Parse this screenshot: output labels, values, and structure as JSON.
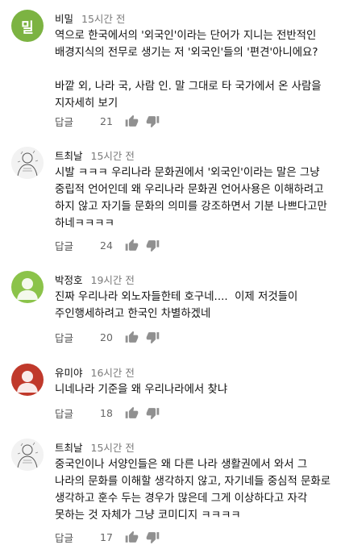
{
  "comments": [
    {
      "author": "비밀",
      "time": "15시간 전",
      "avatar_type": "letter",
      "avatar_letter": "밀",
      "avatar_color": "#7cb342",
      "text": "역으로 한국에서의 '외국인'이라는 단어가 지니는 전반적인 배경지식의 전무로 생기는 저 '외국인'들의 '편견'아니에요?\n\n바깥 외, 나라 국, 사람 인. 말 그대로 타 국가에서 온 사람을 지자세히 보기",
      "reply": "답글",
      "likes": "21"
    },
    {
      "author": "트최날",
      "time": "15시간 전",
      "avatar_type": "sketch",
      "text": "시발 ㅋㅋㅋ 우리나라 문화권에서 '외국인'이라는 말은 그냥 중립적 언어인데 왜 우리나라 문화권 언어사용은 이해하려고 하지 않고 자기들 문화의 의미를 강조하면서 기분 나쁘다고만 하네ㅋㅋㅋㅋ",
      "reply": "답글",
      "likes": "24"
    },
    {
      "author": "박정호",
      "time": "19시간 전",
      "avatar_type": "silhouette",
      "avatar_color": "#8bc34a",
      "text": "진짜 우리나라 외노자들한테 호구네....  이제 저것들이 주인행세하려고 한국인 차별하겠네",
      "reply": "답글",
      "likes": "20"
    },
    {
      "author": "유미야",
      "time": "16시간 전",
      "avatar_type": "silhouette",
      "avatar_color": "#c0392b",
      "text": "니네나라 기준을 왜 우리나라에서 찾냐",
      "reply": "답글",
      "likes": "18"
    },
    {
      "author": "트최날",
      "time": "15시간 전",
      "avatar_type": "sketch",
      "text": "중국인이나 서양인들은 왜 다른 나라 생활권에서 와서 그 나라의 문화를 이해할 생각하지 않고, 자기네들 중심적 문화로 생각하고 훈수 두는 경우가 많은데 그게 이상하다고 자각 못하는 것 자체가 그냥 코미디지 ㅋㅋㅋㅋ",
      "reply": "답글",
      "likes": "17"
    }
  ]
}
